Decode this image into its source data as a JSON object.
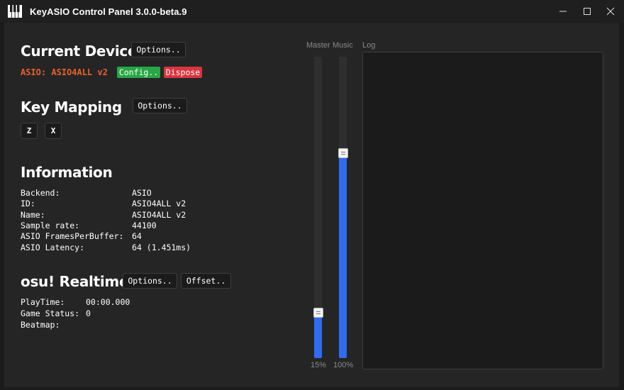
{
  "window": {
    "title": "KeyASIO Control Panel 3.0.0-beta.9"
  },
  "current_device": {
    "heading": "Current Device",
    "options_label": "Options..",
    "device_text": "ASIO: ASIO4ALL v2",
    "config_label": "Config..",
    "dispose_label": "Dispose"
  },
  "key_mapping": {
    "heading": "Key Mapping",
    "options_label": "Options..",
    "keys": [
      "Z",
      "X"
    ]
  },
  "information": {
    "heading": "Information",
    "rows": [
      {
        "label": "Backend:",
        "value": "ASIO"
      },
      {
        "label": "ID:",
        "value": "ASIO4ALL v2"
      },
      {
        "label": "Name:",
        "value": "ASIO4ALL v2"
      },
      {
        "label": "Sample rate:",
        "value": "44100"
      },
      {
        "label": "ASIO FramesPerBuffer:",
        "value": "64"
      },
      {
        "label": "ASIO Latency:",
        "value": "64 (1.451ms)"
      }
    ]
  },
  "osu_realtime": {
    "heading": "osu! Realtime",
    "options_label": "Options..",
    "offset_label": "Offset..",
    "rows": [
      {
        "label": "PlayTime:",
        "value": "00:00.000"
      },
      {
        "label": "Game Status:",
        "value": "0"
      },
      {
        "label": "Beatmap:",
        "value": ""
      }
    ]
  },
  "mixer": {
    "master": {
      "label": "Master",
      "value_text": "15%",
      "level": 0.15
    },
    "music": {
      "label": "Music",
      "value_text": "100%",
      "level": 0.68
    }
  },
  "log": {
    "label": "Log"
  },
  "colors": {
    "accent": "#2f6cf0",
    "device": "#e8612c",
    "config": "#27a745",
    "dispose": "#d9343f"
  }
}
